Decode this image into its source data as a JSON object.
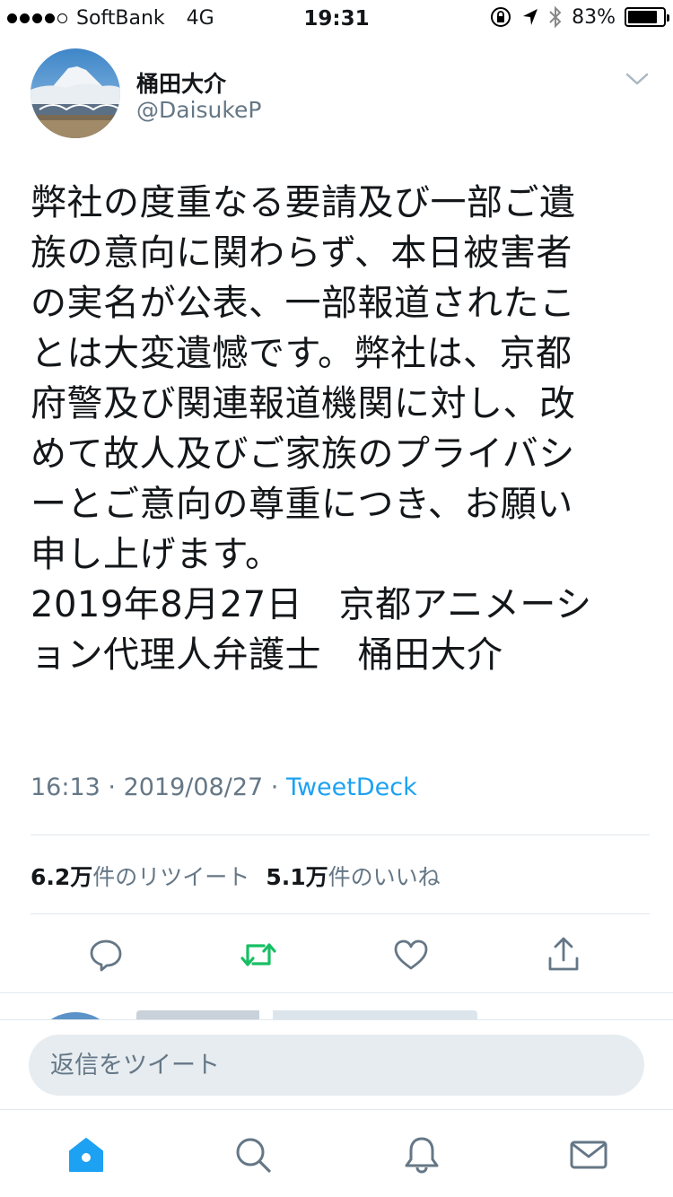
{
  "status_bar": {
    "carrier": "SoftBank",
    "network": "4G",
    "time": "19:31",
    "battery": "83%",
    "battery_level": 0.83,
    "icons": [
      "signal-dots",
      "orientation-lock-icon",
      "location-arrow-icon",
      "bluetooth-icon",
      "battery-icon"
    ]
  },
  "tweet": {
    "author_name": "桶田大介",
    "author_handle": "@DaisukeP",
    "text": "弊社の度重なる要請及び一部ご遺\n族の意向に関わらず、本日被害者\nの実名が公表、一部報道されたこ\nとは大変遺憾です。弊社は、京都\n府警及び関連報道機関に対し、改\nめて故人及びご家族のプライバシ\nーとご意向の尊重につき、お願い\n申し上げます。\n2019年8月27日　京都アニメーシ\nョン代理人弁護士　桶田大介",
    "time": "16:13",
    "separator": " · ",
    "date": "2019/08/27",
    "source": "TweetDeck"
  },
  "stats": {
    "retweets_count": "6.2万",
    "retweets_label": "件のリツイート",
    "likes_count": "5.1万",
    "likes_label": "件のいいね"
  },
  "actions": [
    "reply-icon",
    "retweet-icon",
    "like-icon",
    "share-icon"
  ],
  "compose": {
    "placeholder": "返信をツイート"
  },
  "tabbar": [
    "home-icon",
    "search-icon",
    "notifications-icon",
    "messages-icon"
  ],
  "colors": {
    "accent": "#1da1f2",
    "retweet": "#17bf63",
    "secondary_text": "#657786",
    "icon_gray": "#657786"
  }
}
